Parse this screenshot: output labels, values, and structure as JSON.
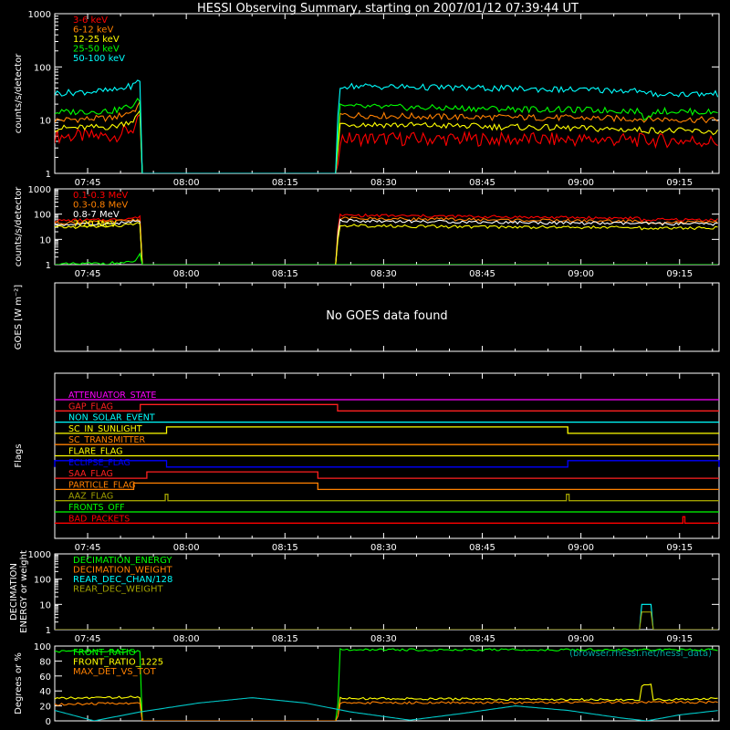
{
  "title": "HESSI Observing Summary, starting on 2007/01/12 07:39:44 UT",
  "chart_data": [
    {
      "type": "line",
      "ylabel": "counts/s/detector",
      "yscale": "log",
      "ylim": [
        1,
        1000
      ],
      "yticks": [
        "1",
        "10",
        "100",
        "1000"
      ],
      "xticks": [
        "07:45",
        "08:00",
        "08:15",
        "08:30",
        "08:45",
        "09:00",
        "09:15"
      ],
      "xrange_minutes": [
        0,
        101
      ],
      "legend_position": "top-left",
      "series": [
        {
          "name": "3-6 keV",
          "color": "#ff0000",
          "points": [
            [
              0,
              5
            ],
            [
              9,
              5
            ],
            [
              12,
              7
            ],
            [
              13,
              10
            ],
            [
              13.2,
              1
            ],
            [
              43,
              1
            ],
            [
              43.2,
              4.5
            ],
            [
              80,
              4.3
            ],
            [
              97,
              4.1
            ],
            [
              101,
              3.9
            ]
          ]
        },
        {
          "name": "6-12 keV",
          "color": "#ff8000",
          "points": [
            [
              0,
              10
            ],
            [
              9,
              11
            ],
            [
              12,
              15
            ],
            [
              13,
              20
            ],
            [
              13.2,
              1
            ],
            [
              43,
              1
            ],
            [
              43.2,
              12.5
            ],
            [
              60,
              11.5
            ],
            [
              80,
              11
            ],
            [
              90,
              10.5
            ],
            [
              101,
              10
            ]
          ]
        },
        {
          "name": "12-25 keV",
          "color": "#ffff00",
          "points": [
            [
              0,
              7
            ],
            [
              9,
              7.5
            ],
            [
              12,
              10
            ],
            [
              13,
              14
            ],
            [
              13.2,
              1
            ],
            [
              43,
              1
            ],
            [
              43.2,
              8.5
            ],
            [
              80,
              7
            ],
            [
              90,
              6.5
            ],
            [
              101,
              6
            ]
          ]
        },
        {
          "name": "25-50 keV",
          "color": "#00ff00",
          "points": [
            [
              0,
              14
            ],
            [
              9,
              15
            ],
            [
              12,
              19
            ],
            [
              13,
              25
            ],
            [
              13.2,
              1
            ],
            [
              43,
              1
            ],
            [
              43.2,
              18
            ],
            [
              80,
              15.5
            ],
            [
              89,
              15
            ],
            [
              89.3,
              11
            ],
            [
              90.5,
              11
            ],
            [
              90.8,
              15
            ],
            [
              101,
              14
            ]
          ]
        },
        {
          "name": "50-100 keV",
          "color": "#00ffff",
          "points": [
            [
              0,
              32
            ],
            [
              9,
              36
            ],
            [
              12,
              45
            ],
            [
              13,
              58
            ],
            [
              13.2,
              1
            ],
            [
              43,
              1
            ],
            [
              43.2,
              44
            ],
            [
              80,
              37
            ],
            [
              89,
              36
            ],
            [
              89.3,
              31
            ],
            [
              101,
              31
            ]
          ]
        }
      ]
    },
    {
      "type": "line",
      "ylabel": "counts/s/detector",
      "yscale": "log",
      "ylim": [
        1,
        1000
      ],
      "yticks": [
        "1",
        "10",
        "100",
        "1000"
      ],
      "xticks": [
        "07:45",
        "08:00",
        "08:15",
        "08:30",
        "08:45",
        "09:00",
        "09:15"
      ],
      "xrange_minutes": [
        0,
        101
      ],
      "legend_position": "top-left",
      "series": [
        {
          "name": "0.1-0.3 MeV",
          "color": "#ff0000",
          "points": [
            [
              0,
              55
            ],
            [
              9,
              60
            ],
            [
              13,
              75
            ],
            [
              13.2,
              1
            ],
            [
              43,
              1
            ],
            [
              43.2,
              90
            ],
            [
              60,
              82
            ],
            [
              80,
              72
            ],
            [
              89,
              68
            ],
            [
              89.3,
              56
            ],
            [
              91,
              60
            ],
            [
              101,
              60
            ]
          ]
        },
        {
          "name": "0.3-0.8 MeV",
          "color": "#ff8000",
          "points": [
            [
              0,
              45
            ],
            [
              9,
              50
            ],
            [
              13,
              62
            ],
            [
              13.2,
              1
            ],
            [
              43,
              1
            ],
            [
              43.2,
              68
            ],
            [
              60,
              62
            ],
            [
              80,
              54
            ],
            [
              89,
              52
            ],
            [
              89.3,
              44
            ],
            [
              91,
              48
            ],
            [
              101,
              47
            ]
          ]
        },
        {
          "name": "0.8-7 MeV",
          "color": "#ffffff",
          "points": [
            [
              0,
              38
            ],
            [
              9,
              42
            ],
            [
              13,
              52
            ],
            [
              13.2,
              1
            ],
            [
              43,
              1
            ],
            [
              43.2,
              55
            ],
            [
              60,
              50
            ],
            [
              80,
              44
            ],
            [
              101,
              40
            ]
          ]
        },
        {
          "name": "7-20 MeV",
          "color": "#ffff00",
          "points": [
            [
              0,
              30
            ],
            [
              9,
              33
            ],
            [
              13,
              42
            ],
            [
              13.2,
              1
            ],
            [
              43,
              1
            ],
            [
              43.2,
              35
            ],
            [
              60,
              32
            ],
            [
              80,
              30
            ],
            [
              89,
              29
            ],
            [
              89.3,
              26
            ],
            [
              91,
              28
            ],
            [
              101,
              28
            ]
          ]
        },
        {
          "name": "",
          "color": "#00ff00",
          "points": [
            [
              0,
              1
            ],
            [
              12,
              1.2
            ],
            [
              13,
              2.5
            ],
            [
              13.2,
              1
            ],
            [
              101,
              1
            ]
          ]
        }
      ]
    },
    {
      "type": "line",
      "ylabel": "GOES [W m⁻²]",
      "message": "No GOES data found",
      "series": []
    },
    {
      "type": "flags",
      "ylabel": "Flags",
      "xticks": [
        "07:45",
        "08:00",
        "08:15",
        "08:30",
        "08:45",
        "09:00",
        "09:15"
      ],
      "xrange_minutes": [
        0,
        101
      ],
      "flags": [
        {
          "name": "ATTENUATOR_STATE",
          "color": "#ff00ff",
          "on": []
        },
        {
          "name": "GAP_FLAG",
          "color": "#ff2020",
          "on": [
            [
              13,
              43
            ]
          ]
        },
        {
          "name": "NON_SOLAR_EVENT",
          "color": "#00ffff",
          "on": []
        },
        {
          "name": "SC_IN_SUNLIGHT",
          "color": "#ffff00",
          "on": [
            [
              17,
              78
            ]
          ]
        },
        {
          "name": "SC_TRANSMITTER",
          "color": "#ff8000",
          "on": []
        },
        {
          "name": "FLARE_FLAG",
          "color": "#ffff00",
          "on": []
        },
        {
          "name": "ECLIPSE_FLAG",
          "color": "#0000ff",
          "on": [
            [
              0,
              17
            ],
            [
              78,
              101
            ]
          ]
        },
        {
          "name": "SAA_FLAG",
          "color": "#ff2020",
          "on": [
            [
              14,
              40
            ]
          ]
        },
        {
          "name": "PARTICLE_FLAG",
          "color": "#ff8000",
          "on": [
            [
              12,
              40
            ]
          ]
        },
        {
          "name": "AAZ_FLAG",
          "color": "#a0a000",
          "on": [
            [
              16.8,
              17.2
            ],
            [
              77.8,
              78.2
            ]
          ]
        },
        {
          "name": "FRONTS_OFF",
          "color": "#00ff00",
          "on": []
        },
        {
          "name": "BAD_PACKETS",
          "color": "#ff0000",
          "on": [
            [
              95.5,
              95.8
            ]
          ]
        }
      ]
    },
    {
      "type": "line",
      "ylabel": "DECIMATION ENERGY or weight",
      "yscale": "log",
      "ylim": [
        1,
        1000
      ],
      "yticks": [
        "1",
        "10",
        "100",
        "1000"
      ],
      "xticks": [
        "07:45",
        "08:00",
        "08:15",
        "08:30",
        "08:45",
        "09:00",
        "09:15"
      ],
      "xrange_minutes": [
        0,
        101
      ],
      "legend_position": "top-left",
      "series": [
        {
          "name": "DECIMATION_ENERGY",
          "color": "#00ff00",
          "points": []
        },
        {
          "name": "DECIMATION_WEIGHT",
          "color": "#ff8000",
          "points": []
        },
        {
          "name": "REAR_DEC_CHAN/128",
          "color": "#00ffff",
          "points": [
            [
              0,
              1
            ],
            [
              89,
              1
            ],
            [
              89,
              10
            ],
            [
              90.8,
              10
            ],
            [
              90.8,
              1
            ],
            [
              101,
              1
            ]
          ]
        },
        {
          "name": "REAR_DEC_WEIGHT",
          "color": "#a0a000",
          "points": [
            [
              0,
              1
            ],
            [
              89,
              1
            ],
            [
              89,
              5
            ],
            [
              90.8,
              5
            ],
            [
              90.8,
              1
            ],
            [
              101,
              1
            ]
          ]
        }
      ]
    },
    {
      "type": "line",
      "ylabel": "Degrees or %",
      "ylim": [
        0,
        100
      ],
      "yticks": [
        "0",
        "20",
        "40",
        "60",
        "80",
        "100"
      ],
      "xrange_minutes": [
        0,
        101
      ],
      "legend_position": "top-left",
      "annotation": "(browser.rhessi.net/hessi_data)",
      "series": [
        {
          "name": "FRONT_RATIO",
          "color": "#00ff00",
          "points": [
            [
              0,
              93
            ],
            [
              13,
              93
            ],
            [
              13.2,
              0
            ],
            [
              43,
              0
            ],
            [
              43.2,
              95
            ],
            [
              101,
              95
            ]
          ]
        },
        {
          "name": "FRONT_RATIO_1225",
          "color": "#ffff00",
          "points": [
            [
              0,
              30
            ],
            [
              13,
              32
            ],
            [
              13.2,
              0
            ],
            [
              43,
              0
            ],
            [
              43.2,
              30
            ],
            [
              89,
              28
            ],
            [
              89.3,
              48
            ],
            [
              90.8,
              48
            ],
            [
              91,
              28
            ],
            [
              101,
              30
            ]
          ]
        },
        {
          "name": "MAX_DET_VS_TOT",
          "color": "#ff8000",
          "points": [
            [
              0,
              22
            ],
            [
              13,
              24
            ],
            [
              13.2,
              0
            ],
            [
              43,
              0
            ],
            [
              43.2,
              24
            ],
            [
              101,
              25
            ]
          ]
        },
        {
          "name": "",
          "color": "#00c8c8",
          "points": [
            [
              0,
              14
            ],
            [
              6,
              0
            ],
            [
              13,
              12
            ],
            [
              22,
              24
            ],
            [
              30,
              31
            ],
            [
              38,
              24
            ],
            [
              45,
              12
            ],
            [
              54,
              1
            ],
            [
              62,
              10
            ],
            [
              70,
              20
            ],
            [
              78,
              14
            ],
            [
              86,
              4
            ],
            [
              90,
              0
            ],
            [
              95,
              8
            ],
            [
              101,
              14
            ]
          ]
        }
      ]
    }
  ]
}
